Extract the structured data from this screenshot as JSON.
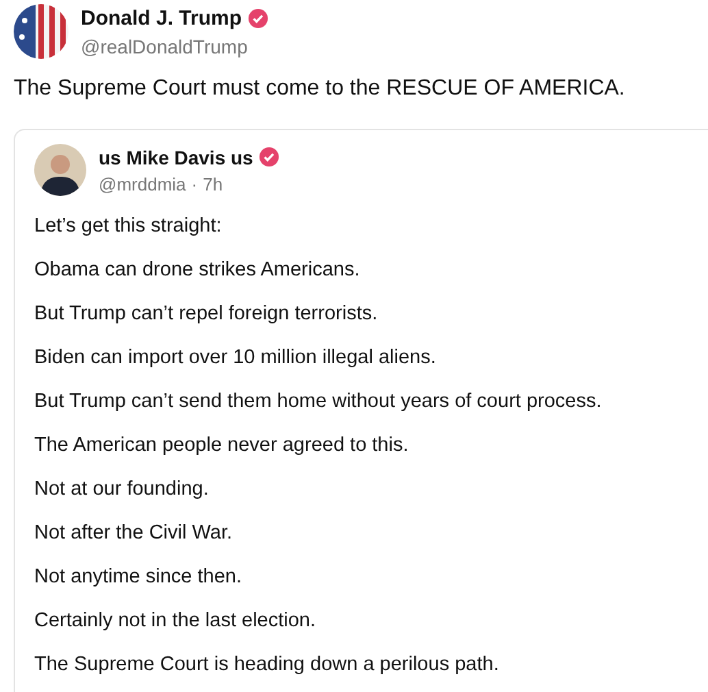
{
  "post": {
    "author": {
      "name": "Donald J. Trump",
      "verified": true,
      "handle": "@realDonaldTrump"
    },
    "text": "The Supreme Court must come to the RESCUE OF AMERICA.",
    "quote": {
      "author": {
        "name": "us Mike Davis us",
        "verified": true,
        "handle": "@mrddmia",
        "time": "7h"
      },
      "separator": "·",
      "paragraphs": [
        "Let’s get this straight:",
        "Obama can drone strikes Americans.",
        "But Trump can’t repel foreign terrorists.",
        "Biden can import over 10 million illegal aliens.",
        "But Trump can’t send them home without years of court process.",
        "The American people never agreed to this.",
        "Not at our founding.",
        "Not after the Civil War.",
        "Not anytime since then.",
        "Certainly not in the last election.",
        "The Supreme Court is heading down a perilous path."
      ]
    }
  }
}
